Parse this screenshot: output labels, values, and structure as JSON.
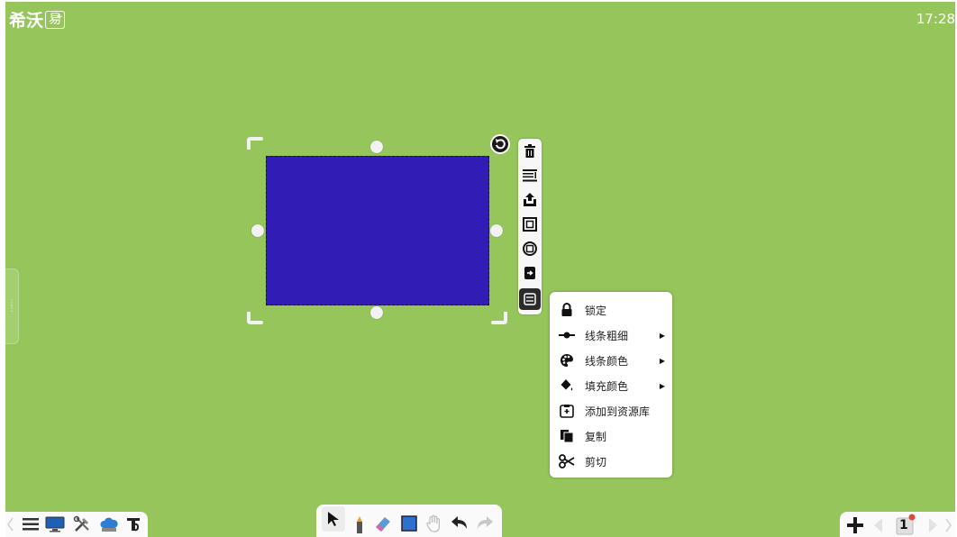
{
  "app": {
    "logo_text": "希沃",
    "logo_box_text": "易",
    "logo_sup": "+",
    "clock": "17:28"
  },
  "colors": {
    "canvas_bg": "#95c55b",
    "shape_fill": "#311db6",
    "menu_bg": "#ffffff",
    "toolbar_active": "#2b2b2b"
  },
  "selection_toolbar": {
    "items": [
      {
        "icon": "trash-icon"
      },
      {
        "icon": "align-icon"
      },
      {
        "icon": "bring-front-icon"
      },
      {
        "icon": "frame-square-icon"
      },
      {
        "icon": "frame-circle-icon"
      },
      {
        "icon": "export-icon"
      },
      {
        "icon": "more-menu-icon",
        "active": true
      }
    ]
  },
  "context_menu": {
    "items": [
      {
        "label": "锁定",
        "icon": "lock-icon",
        "submenu": false
      },
      {
        "label": "线条粗细",
        "icon": "line-width-icon",
        "submenu": true
      },
      {
        "label": "线条颜色",
        "icon": "palette-icon",
        "submenu": true
      },
      {
        "label": "填充颜色",
        "icon": "fill-bucket-icon",
        "submenu": true
      },
      {
        "label": "添加到资源库",
        "icon": "library-add-icon",
        "submenu": false
      },
      {
        "label": "复制",
        "icon": "copy-icon",
        "submenu": false
      },
      {
        "label": "剪切",
        "icon": "scissors-icon",
        "submenu": false
      }
    ]
  },
  "bottom_left": {
    "items": [
      "menu-icon",
      "desktop-icon",
      "tools-icon",
      "cloud-icon",
      "text-icon"
    ]
  },
  "bottom_center": {
    "items": [
      "select-arrow-icon",
      "pen-icon",
      "eraser-icon",
      "shape-icon",
      "hand-icon",
      "undo-icon",
      "redo-icon"
    ]
  },
  "bottom_right": {
    "items": [
      "add-page-icon",
      "prev-page-icon",
      "page-thumb-icon",
      "next-page-icon"
    ],
    "page_number": "1"
  }
}
